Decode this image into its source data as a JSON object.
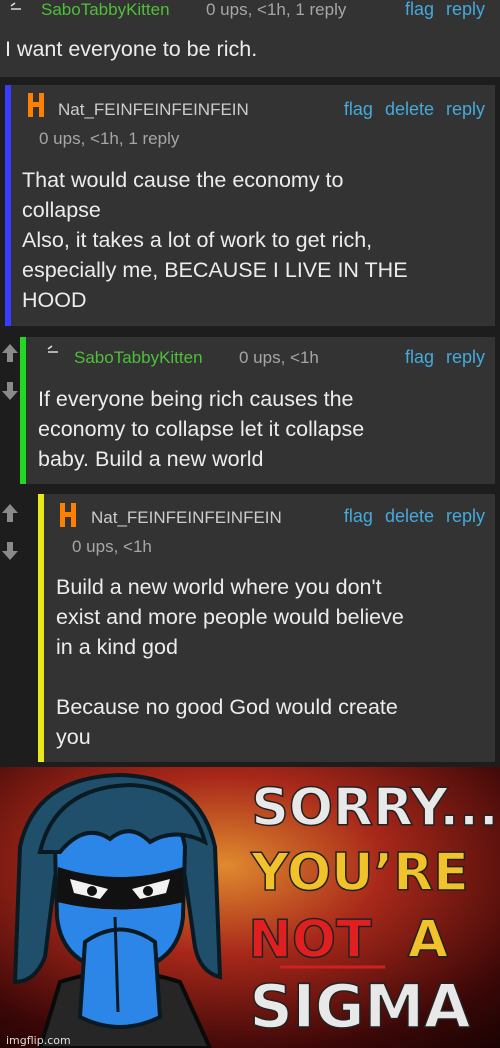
{
  "comments": [
    {
      "username": "SaboTabbyKitten",
      "meta": "0 ups, <1h, 1 reply",
      "actions": [
        "flag",
        "reply"
      ],
      "body": "I want everyone to be rich."
    },
    {
      "username": "Nat_FEINFEINFEINFEIN",
      "meta": "0 ups, <1h, 1 reply",
      "actions": [
        "flag",
        "delete",
        "reply"
      ],
      "body": "That would cause the economy to\ncollapse\nAlso, it takes a lot of work to get rich,\nespecially me, BECAUSE I LIVE IN THE\nHOOD"
    },
    {
      "username": "SaboTabbyKitten",
      "meta": "0 ups, <1h",
      "actions": [
        "flag",
        "reply"
      ],
      "body": "If everyone being rich causes the\neconomy to collapse let it collapse\nbaby. Build a new world"
    },
    {
      "username": "Nat_FEINFEINFEINFEIN",
      "meta": "0 ups, <1h",
      "actions": [
        "flag",
        "delete",
        "reply"
      ],
      "body": "Build a new world where you don't\nexist and more people would believe\nin a kind god\n\nBecause no good God would create\nyou"
    }
  ],
  "meme": {
    "line1": "SORRY...",
    "line2": "YOU’RE",
    "line3a": "NOT",
    "line3b": "A",
    "line4": "SIGMA",
    "watermark": "imgflip.com"
  },
  "colors": {
    "panel": "#333333",
    "green_user": "#4fbf3a",
    "link": "#45a9dc",
    "bar_blue": "#3b3bff",
    "bar_green": "#22d822",
    "bar_yellow": "#e8e81b",
    "h_icon": "#ff7f00"
  },
  "icons": [
    "minus-icon",
    "h-logo-icon",
    "upvote-icon",
    "downvote-icon"
  ]
}
